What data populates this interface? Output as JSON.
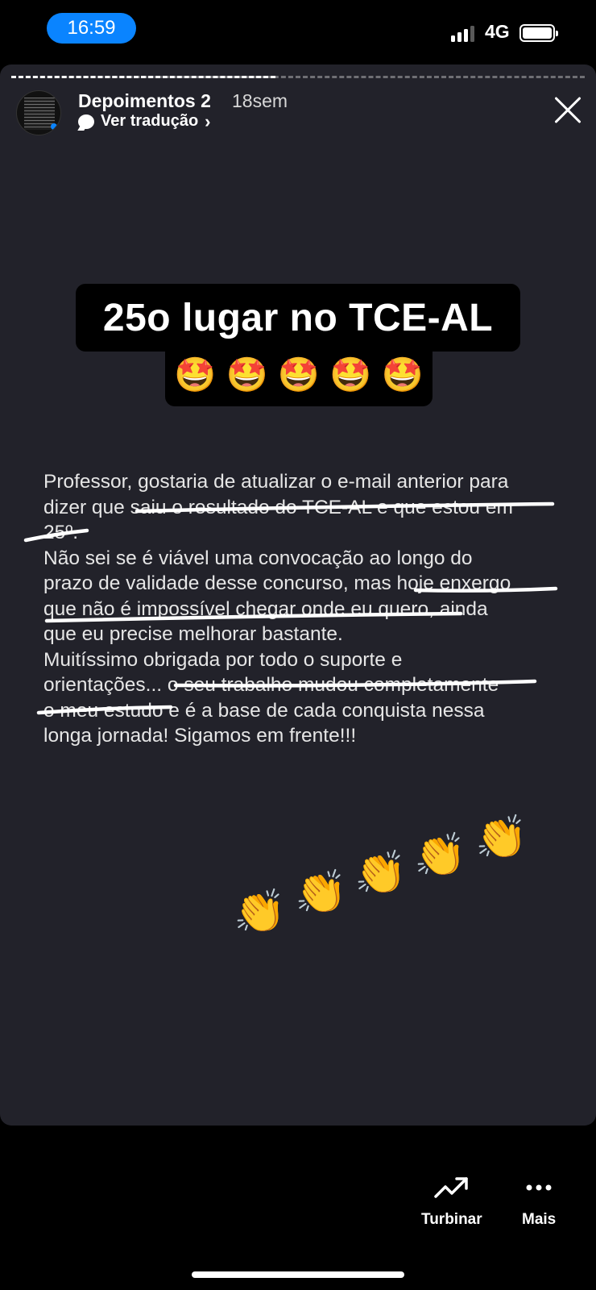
{
  "status_bar": {
    "time": "16:59",
    "network": "4G",
    "signal_bars_active": 3,
    "signal_bars_total": 4
  },
  "story": {
    "profile_name": "Depoimentos 2",
    "age": "18sem",
    "translate_label": "Ver tradução",
    "progress_fraction": 0.46,
    "headline": "25o lugar no TCE-AL",
    "headline_emojis": [
      "🤩",
      "🤩",
      "🤩",
      "🤩",
      "🤩"
    ],
    "testimonial_lines": [
      "Professor, gostaria de atualizar o e-mail anterior para",
      "dizer que saiu o resultado do TCE-AL e que estou em",
      "25º.",
      "Não sei se é viável uma convocação ao longo do",
      "prazo de validade desse concurso, mas hoje enxergo",
      "que não é impossível chegar onde eu quero, ainda",
      "que eu precise melhorar bastante.",
      "Muitíssimo obrigada por todo o suporte e",
      "orientações... o seu trabalho mudou completamente",
      "o meu estudo e é a base de cada conquista nessa",
      "longa jornada! Sigamos em frente!!!"
    ],
    "clap_emojis": [
      "👏",
      "👏",
      "👏",
      "👏",
      "👏"
    ]
  },
  "actions": {
    "boost_label": "Turbinar",
    "more_label": "Mais"
  },
  "colors": {
    "time_pill": "#0a84ff",
    "story_background": "#22222a",
    "page_background": "#000000",
    "underline": "#ffffff"
  },
  "icons": {
    "boost": "trending-up-icon",
    "more": "more-horizontal-icon",
    "close": "close-icon",
    "translate": "speech-bubble-icon"
  }
}
